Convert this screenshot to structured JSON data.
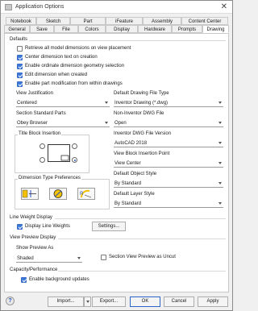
{
  "window": {
    "title": "Application Options",
    "close_glyph": "✕"
  },
  "tabs_row1": [
    "Notebook",
    "Sketch",
    "Part",
    "iFeature",
    "Assembly",
    "Content Center"
  ],
  "tabs_row2": [
    "General",
    "Save",
    "File",
    "Colors",
    "Display",
    "Hardware",
    "Prompts",
    "Drawing"
  ],
  "active_tab": "Drawing",
  "defaults": {
    "heading": "Defaults",
    "checks": [
      {
        "label": "Retrieve all model dimensions on view placement",
        "checked": false
      },
      {
        "label": "Center dimension text on creation",
        "checked": true
      },
      {
        "label": "Enable ordinate dimension geometry selection",
        "checked": true
      },
      {
        "label": "Edit dimension when created",
        "checked": true
      },
      {
        "label": "Enable part modification from within drawings",
        "checked": true
      }
    ]
  },
  "left_fields": {
    "view_justification": {
      "label": "View Justification",
      "value": "Centered"
    },
    "section_standard_parts": {
      "label": "Section Standard Parts",
      "value": "Obey Browser"
    },
    "title_block_insertion": {
      "label": "Title Block Insertion"
    },
    "dimension_type_prefs": {
      "label": "Dimension Type Preferences"
    }
  },
  "right_fields": {
    "default_file_type": {
      "label": "Default Drawing File Type",
      "value": "Inventor Drawing (*.dwg)"
    },
    "non_inventor_dwg": {
      "label": "Non-Inventor DWG File",
      "value": "Open"
    },
    "dwg_version": {
      "label": "Inventor DWG File Version",
      "value": "AutoCAD 2018"
    },
    "view_block_insertion": {
      "label": "View Block Insertion Point",
      "value": "View Center"
    },
    "default_object_style": {
      "label": "Default Object Style",
      "value": "By Standard"
    },
    "default_layer_style": {
      "label": "Default Layer Style",
      "value": "By Standard"
    }
  },
  "line_weight": {
    "heading": "Line Weight Display",
    "check_label": "Display Line Weights",
    "checked": true,
    "settings_button": "Settings..."
  },
  "view_preview": {
    "heading": "View Preview Display",
    "show_as_label": "Show Preview As",
    "show_as_value": "Shaded",
    "section_label": "Section View Preview as Uncut",
    "section_checked": false
  },
  "capacity": {
    "heading": "Capacity/Performance",
    "check_label": "Enable background updates",
    "checked": true
  },
  "footer": {
    "help_glyph": "?",
    "import": "Import...",
    "export": "Export...",
    "ok": "OK",
    "cancel": "Cancel",
    "apply": "Apply"
  },
  "icons": [
    "app-icon",
    "close-icon",
    "caret-down-icon",
    "title-block-icon",
    "dimension-linear-icon",
    "dimension-diameter-icon",
    "dimension-radius-icon",
    "help-icon"
  ],
  "colors": {
    "accent": "#3b78d8",
    "panel": "#ffffff",
    "chrome": "#f0f0f0"
  }
}
